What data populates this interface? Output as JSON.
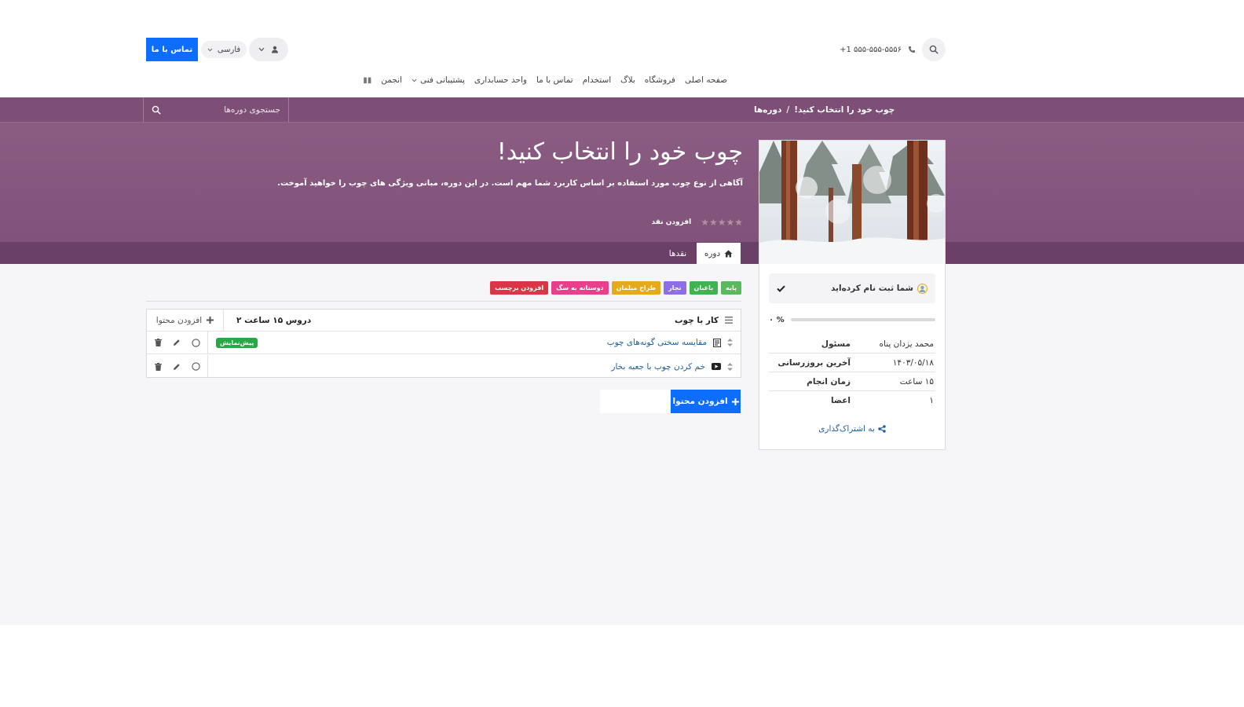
{
  "header": {
    "phone": "+1 ۵۵۵-۵۵۵-۵۵۵۶",
    "contact_button": "تماس با ما",
    "language": "فارسی"
  },
  "menu": {
    "items": [
      "صفحه اصلی",
      "فروشگاه",
      "بلاگ",
      "استخدام",
      "تماس با ما",
      "واحد حسابداری",
      "پشتیبانی فنی",
      "انجمن"
    ]
  },
  "breadcrumb": {
    "root": "دوره‌ها",
    "separator": "/",
    "current": "چوب خود را انتخاب کنید!"
  },
  "course_search": {
    "placeholder": "جستجوی دوره‌ها"
  },
  "course": {
    "title": "چوب خود را انتخاب کنید!",
    "description": "آگاهی از نوع چوب مورد استفاده بر اساس کاربرد شما مهم است. در این دوره، مبانی ویژگی های چوب را خواهید آموخت.",
    "stars": "★★★★★",
    "add_review": "افزودن نقد"
  },
  "tabs": {
    "course": "دوره",
    "reviews": "نقدها"
  },
  "sidebar": {
    "enrolled_text": "شما ثبت نام کرده‌اید",
    "progress_label": "۰ %",
    "progress_value": 0,
    "info": [
      {
        "key": "مسئول",
        "value": "محمد یزدان پناه"
      },
      {
        "key": "آخرین بروزرسانی",
        "value": "۱۴۰۳/۰۵/۱۸"
      },
      {
        "key": "زمان انجام",
        "value": "۱۵ ساعت"
      },
      {
        "key": "اعضا",
        "value": "۱"
      }
    ],
    "share": "به اشتراک‌گذاری"
  },
  "tags": [
    {
      "label": "پایه",
      "color": "#5cb85c"
    },
    {
      "label": "باغبان",
      "color": "#3fb34f"
    },
    {
      "label": "نجار",
      "color": "#8e6ee8"
    },
    {
      "label": "طراح مبلمان",
      "color": "#e6a91a"
    },
    {
      "label": "دوستانه به سگ",
      "color": "#e83e8c"
    },
    {
      "label": "افزودن برچسب",
      "color": "#dc3545"
    }
  ],
  "section": {
    "title": "کار با چوب",
    "meta": "۲ دروس ۱۵ ساعت",
    "add_content": "افزودن محتوا"
  },
  "lessons": [
    {
      "title": "مقایسه سختی گونه‌های چوب",
      "icon": "document-icon",
      "badge": "پیش‌نمایش"
    },
    {
      "title": "خم کردن چوب با جعبه بخار",
      "icon": "video-icon",
      "badge": ""
    }
  ],
  "add_content_button": "افزودن محتوا"
}
